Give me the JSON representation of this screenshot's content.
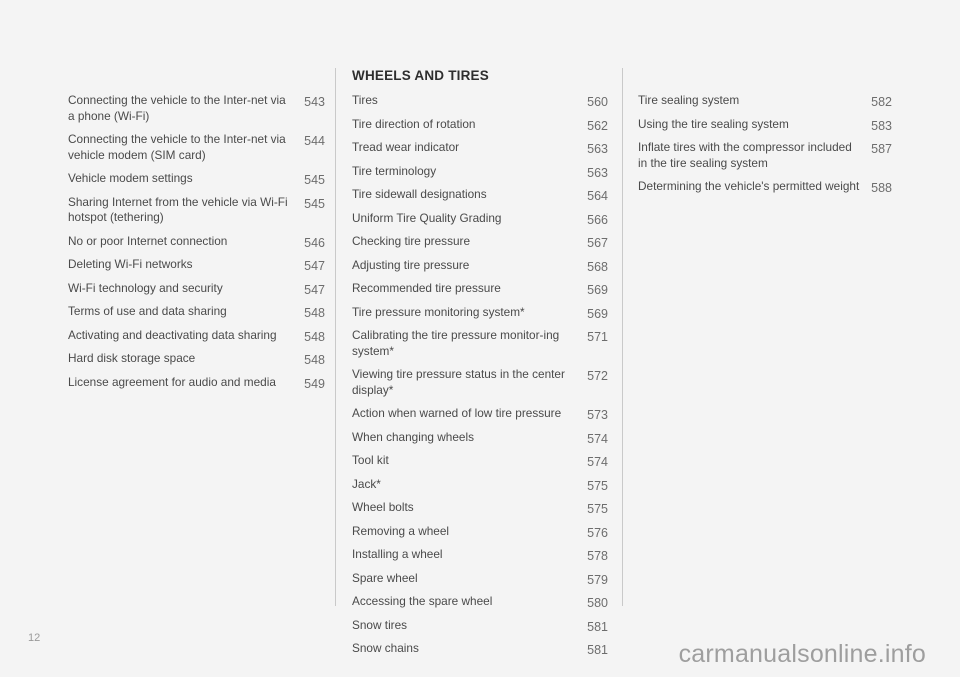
{
  "document": {
    "folio": "12",
    "watermark": "carmanualsonline.info"
  },
  "columns": [
    {
      "heading": null,
      "entries": [
        {
          "title": "Connecting the vehicle to the Inter-net via a phone (Wi-Fi)",
          "page": "543"
        },
        {
          "title": "Connecting the vehicle to the Inter-net via vehicle modem (SIM card)",
          "page": "544"
        },
        {
          "title": "Vehicle modem settings",
          "page": "545"
        },
        {
          "title": "Sharing Internet from the vehicle via Wi-Fi hotspot (tethering)",
          "page": "545"
        },
        {
          "title": "No or poor Internet connection",
          "page": "546"
        },
        {
          "title": "Deleting Wi-Fi networks",
          "page": "547"
        },
        {
          "title": "Wi-Fi technology and security",
          "page": "547"
        },
        {
          "title": "Terms of use and data sharing",
          "page": "548"
        },
        {
          "title": "Activating and deactivating data sharing",
          "page": "548"
        },
        {
          "title": "Hard disk storage space",
          "page": "548"
        },
        {
          "title": "License agreement for audio and media",
          "page": "549"
        }
      ]
    },
    {
      "heading": "WHEELS AND TIRES",
      "entries": [
        {
          "title": "Tires",
          "page": "560"
        },
        {
          "title": "Tire direction of rotation",
          "page": "562"
        },
        {
          "title": "Tread wear indicator",
          "page": "563"
        },
        {
          "title": "Tire terminology",
          "page": "563"
        },
        {
          "title": "Tire sidewall designations",
          "page": "564"
        },
        {
          "title": "Uniform Tire Quality Grading",
          "page": "566"
        },
        {
          "title": "Checking tire pressure",
          "page": "567"
        },
        {
          "title": "Adjusting tire pressure",
          "page": "568"
        },
        {
          "title": "Recommended tire pressure",
          "page": "569"
        },
        {
          "title": "Tire pressure monitoring system*",
          "page": "569"
        },
        {
          "title": "Calibrating the tire pressure monitor-ing system*",
          "page": "571"
        },
        {
          "title": "Viewing tire pressure status in the center display*",
          "page": "572"
        },
        {
          "title": "Action when warned of low tire pressure",
          "page": "573"
        },
        {
          "title": "When changing wheels",
          "page": "574"
        },
        {
          "title": "Tool kit",
          "page": "574"
        },
        {
          "title": "Jack*",
          "page": "575"
        },
        {
          "title": "Wheel bolts",
          "page": "575"
        },
        {
          "title": "Removing a wheel",
          "page": "576"
        },
        {
          "title": "Installing a wheel",
          "page": "578"
        },
        {
          "title": "Spare wheel",
          "page": "579"
        },
        {
          "title": "Accessing the spare wheel",
          "page": "580"
        },
        {
          "title": "Snow tires",
          "page": "581"
        },
        {
          "title": "Snow chains",
          "page": "581"
        }
      ]
    },
    {
      "heading": null,
      "entries": [
        {
          "title": "Tire sealing system",
          "page": "582"
        },
        {
          "title": "Using the tire sealing system",
          "page": "583"
        },
        {
          "title": "Inflate tires with the compressor included in the tire sealing system",
          "page": "587"
        },
        {
          "title": "Determining the vehicle's permitted weight",
          "page": "588"
        }
      ]
    }
  ]
}
